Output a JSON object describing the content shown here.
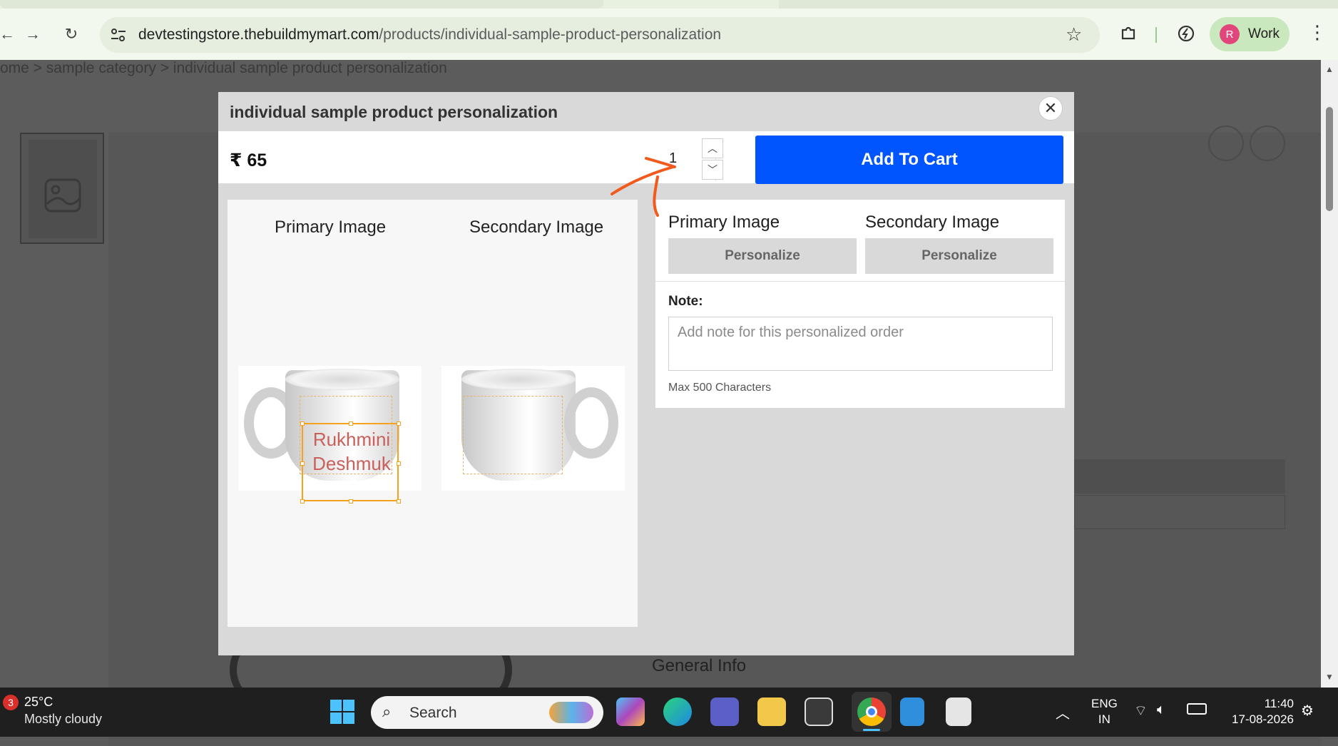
{
  "browser": {
    "url_host": "devtestingstore.thebuildmymart.com",
    "url_path": "/products/individual-sample-product-personalization",
    "profile_initial": "R",
    "profile_label": "Work"
  },
  "page": {
    "breadcrumb": "ome  >  sample category  >  individual sample product personalization",
    "general_info": "General Info"
  },
  "modal": {
    "title": "individual sample product personalization",
    "close_glyph": "✕",
    "price_symbol": "₹",
    "price_value": "65",
    "quantity": "1",
    "add_to_cart_label": "Add To Cart",
    "preview": {
      "primary_label": "Primary Image",
      "secondary_label": "Secondary Image",
      "mug_text_line1": "Rukhmini",
      "mug_text_line2": "Deshmuk"
    },
    "options": {
      "primary_label": "Primary Image",
      "secondary_label": "Secondary Image",
      "personalize_label": "Personalize",
      "note_label": "Note:",
      "note_placeholder": "Add note for this personalized order",
      "note_hint": "Max 500 Characters"
    }
  },
  "taskbar": {
    "weather_badge": "3",
    "weather_temp": "25°C",
    "weather_desc": "Mostly cloudy",
    "search_label": "Search",
    "lang_line1": "ENG",
    "lang_line2": "IN",
    "time": "11:40",
    "date": "17-08-2026"
  },
  "colors": {
    "accent": "#0055ff",
    "annotation": "#f25a1d",
    "selection": "#f5a21e",
    "mug_text": "#c9605c"
  }
}
